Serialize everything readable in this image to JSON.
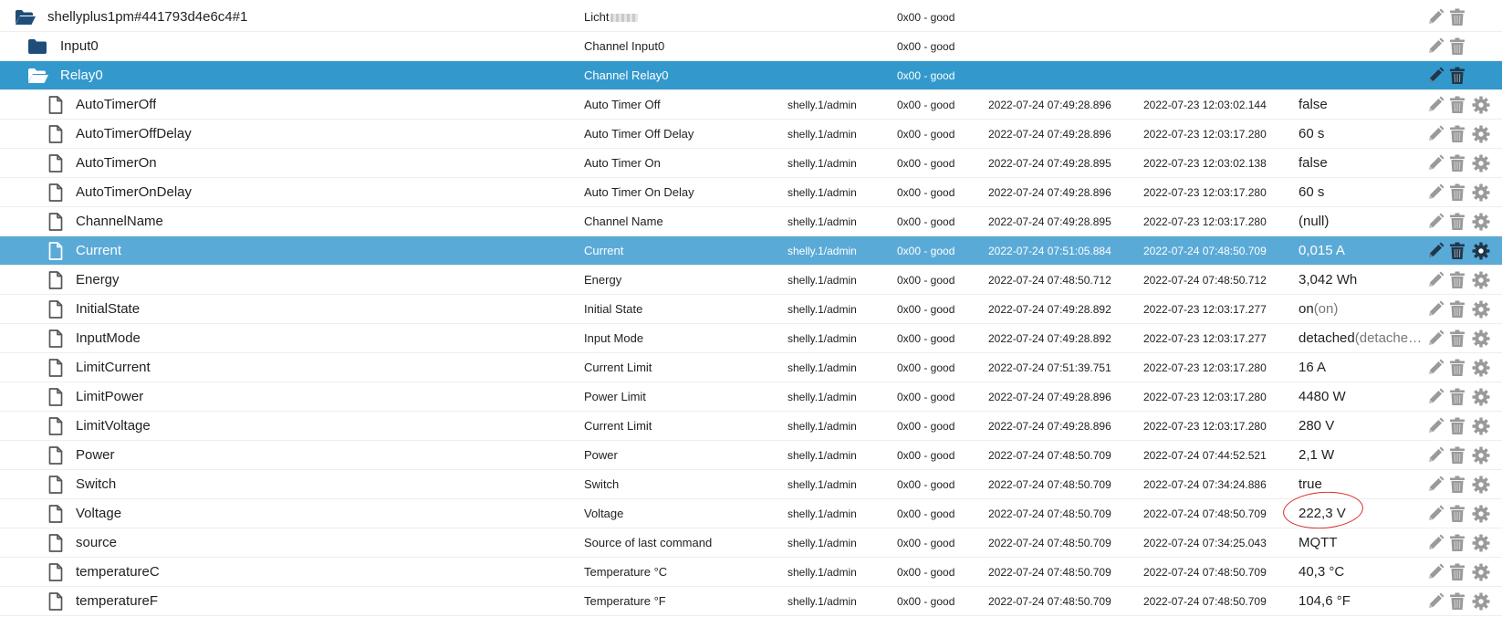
{
  "rows": [
    {
      "id": "shellyplus1pm#441793d4e6c4#1",
      "name": "Licht",
      "blurred": true,
      "role": "",
      "status": "0x00 - good",
      "ts": "",
      "lc": "",
      "value": "",
      "value_sub": "",
      "type": "folder-open",
      "level": 0,
      "gear": false,
      "sel": ""
    },
    {
      "id": "Input0",
      "name": "Channel Input0",
      "role": "",
      "status": "0x00 - good",
      "ts": "",
      "lc": "",
      "value": "",
      "value_sub": "",
      "type": "folder",
      "level": 1,
      "gear": false,
      "sel": ""
    },
    {
      "id": "Relay0",
      "name": "Channel Relay0",
      "role": "",
      "status": "0x00 - good",
      "ts": "",
      "lc": "",
      "value": "",
      "value_sub": "",
      "type": "folder-open",
      "level": 1,
      "gear": false,
      "sel": "dark"
    },
    {
      "id": "AutoTimerOff",
      "name": "Auto Timer Off",
      "role": "shelly.1/admin",
      "status": "0x00 - good",
      "ts": "2022-07-24 07:49:28.896",
      "lc": "2022-07-23 12:03:02.144",
      "value": "false",
      "value_sub": "",
      "type": "file",
      "level": 2,
      "gear": true,
      "sel": ""
    },
    {
      "id": "AutoTimerOffDelay",
      "name": "Auto Timer Off Delay",
      "role": "shelly.1/admin",
      "status": "0x00 - good",
      "ts": "2022-07-24 07:49:28.896",
      "lc": "2022-07-23 12:03:17.280",
      "value": "60 s",
      "value_sub": "",
      "type": "file",
      "level": 2,
      "gear": true,
      "sel": ""
    },
    {
      "id": "AutoTimerOn",
      "name": "Auto Timer On",
      "role": "shelly.1/admin",
      "status": "0x00 - good",
      "ts": "2022-07-24 07:49:28.895",
      "lc": "2022-07-23 12:03:02.138",
      "value": "false",
      "value_sub": "",
      "type": "file",
      "level": 2,
      "gear": true,
      "sel": ""
    },
    {
      "id": "AutoTimerOnDelay",
      "name": "Auto Timer On Delay",
      "role": "shelly.1/admin",
      "status": "0x00 - good",
      "ts": "2022-07-24 07:49:28.896",
      "lc": "2022-07-23 12:03:17.280",
      "value": "60 s",
      "value_sub": "",
      "type": "file",
      "level": 2,
      "gear": true,
      "sel": ""
    },
    {
      "id": "ChannelName",
      "name": "Channel Name",
      "role": "shelly.1/admin",
      "status": "0x00 - good",
      "ts": "2022-07-24 07:49:28.895",
      "lc": "2022-07-23 12:03:17.280",
      "value": "(null)",
      "value_sub": "",
      "type": "file",
      "level": 2,
      "gear": true,
      "sel": ""
    },
    {
      "id": "Current",
      "name": "Current",
      "role": "shelly.1/admin",
      "status": "0x00 - good",
      "ts": "2022-07-24 07:51:05.884",
      "lc": "2022-07-24 07:48:50.709",
      "value": "0,015 A",
      "value_sub": "",
      "type": "file",
      "level": 2,
      "gear": true,
      "sel": "light"
    },
    {
      "id": "Energy",
      "name": "Energy",
      "role": "shelly.1/admin",
      "status": "0x00 - good",
      "ts": "2022-07-24 07:48:50.712",
      "lc": "2022-07-24 07:48:50.712",
      "value": "3,042 Wh",
      "value_sub": "",
      "type": "file",
      "level": 2,
      "gear": true,
      "sel": ""
    },
    {
      "id": "InitialState",
      "name": "Initial State",
      "role": "shelly.1/admin",
      "status": "0x00 - good",
      "ts": "2022-07-24 07:49:28.892",
      "lc": "2022-07-23 12:03:17.277",
      "value": "on",
      "value_sub": "(on)",
      "type": "file",
      "level": 2,
      "gear": true,
      "sel": ""
    },
    {
      "id": "InputMode",
      "name": "Input Mode",
      "role": "shelly.1/admin",
      "status": "0x00 - good",
      "ts": "2022-07-24 07:49:28.892",
      "lc": "2022-07-23 12:03:17.277",
      "value": "detached",
      "value_sub": "(detache…",
      "type": "file",
      "level": 2,
      "gear": true,
      "sel": ""
    },
    {
      "id": "LimitCurrent",
      "name": "Current Limit",
      "role": "shelly.1/admin",
      "status": "0x00 - good",
      "ts": "2022-07-24 07:51:39.751",
      "lc": "2022-07-23 12:03:17.280",
      "value": "16 A",
      "value_sub": "",
      "type": "file",
      "level": 2,
      "gear": true,
      "sel": ""
    },
    {
      "id": "LimitPower",
      "name": "Power Limit",
      "role": "shelly.1/admin",
      "status": "0x00 - good",
      "ts": "2022-07-24 07:49:28.896",
      "lc": "2022-07-23 12:03:17.280",
      "value": "4480 W",
      "value_sub": "",
      "type": "file",
      "level": 2,
      "gear": true,
      "sel": ""
    },
    {
      "id": "LimitVoltage",
      "name": "Current Limit",
      "role": "shelly.1/admin",
      "status": "0x00 - good",
      "ts": "2022-07-24 07:49:28.896",
      "lc": "2022-07-23 12:03:17.280",
      "value": "280 V",
      "value_sub": "",
      "type": "file",
      "level": 2,
      "gear": true,
      "sel": ""
    },
    {
      "id": "Power",
      "name": "Power",
      "role": "shelly.1/admin",
      "status": "0x00 - good",
      "ts": "2022-07-24 07:48:50.709",
      "lc": "2022-07-24 07:44:52.521",
      "value": "2,1 W",
      "value_sub": "",
      "type": "file",
      "level": 2,
      "gear": true,
      "sel": ""
    },
    {
      "id": "Switch",
      "name": "Switch",
      "role": "shelly.1/admin",
      "status": "0x00 - good",
      "ts": "2022-07-24 07:48:50.709",
      "lc": "2022-07-24 07:34:24.886",
      "value": "true",
      "value_sub": "",
      "type": "file",
      "level": 2,
      "gear": true,
      "sel": ""
    },
    {
      "id": "Voltage",
      "name": "Voltage",
      "role": "shelly.1/admin",
      "status": "0x00 - good",
      "ts": "2022-07-24 07:48:50.709",
      "lc": "2022-07-24 07:48:50.709",
      "value": "222,3 V",
      "value_sub": "",
      "type": "file",
      "level": 2,
      "gear": true,
      "sel": ""
    },
    {
      "id": "source",
      "name": "Source of last command",
      "role": "shelly.1/admin",
      "status": "0x00 - good",
      "ts": "2022-07-24 07:48:50.709",
      "lc": "2022-07-24 07:34:25.043",
      "value": "MQTT",
      "value_sub": "",
      "type": "file",
      "level": 2,
      "gear": true,
      "sel": ""
    },
    {
      "id": "temperatureC",
      "name": "Temperature °C",
      "role": "shelly.1/admin",
      "status": "0x00 - good",
      "ts": "2022-07-24 07:48:50.709",
      "lc": "2022-07-24 07:48:50.709",
      "value": "40,3 °C",
      "value_sub": "",
      "type": "file",
      "level": 2,
      "gear": true,
      "sel": ""
    },
    {
      "id": "temperatureF",
      "name": "Temperature °F",
      "role": "shelly.1/admin",
      "status": "0x00 - good",
      "ts": "2022-07-24 07:48:50.709",
      "lc": "2022-07-24 07:48:50.709",
      "value": "104,6 °F",
      "value_sub": "",
      "type": "file",
      "level": 2,
      "gear": true,
      "sel": ""
    }
  ],
  "icons": {
    "folder": "folder-icon",
    "folder_open": "folder-open-icon",
    "file": "file-icon",
    "edit": "pencil-icon",
    "delete": "trash-icon",
    "settings": "gear-icon"
  },
  "colors": {
    "selected_dark": "#3399cc",
    "selected_light": "#5aaad8",
    "folder": "#1f4d7a",
    "action_icon": "#9a9a9a",
    "annotation": "#d92b2b"
  }
}
